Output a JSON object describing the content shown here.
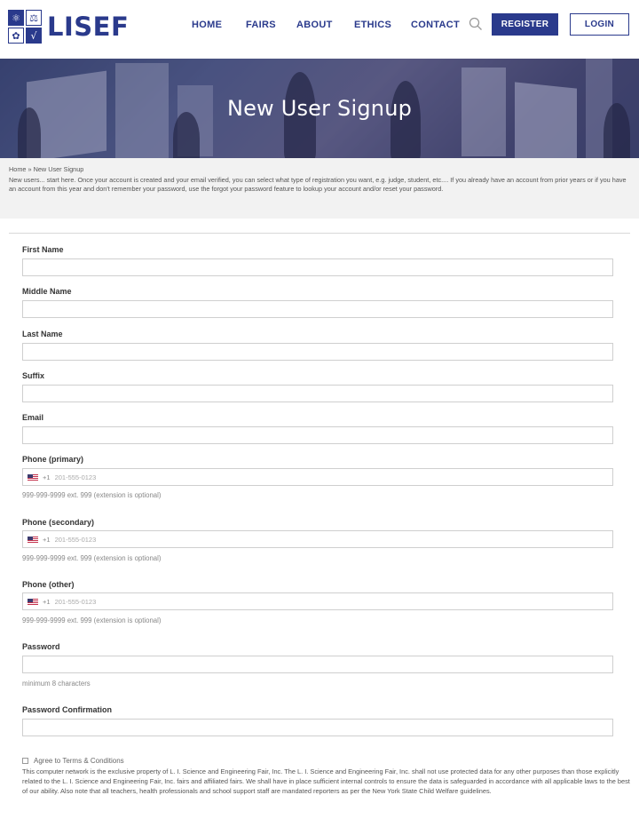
{
  "brand": {
    "name": "LISEF"
  },
  "nav": {
    "home": "HOME",
    "fairs": "FAIRS",
    "about": "ABOUT",
    "ethics": "ETHICS",
    "contact": "CONTACT",
    "register": "REGISTER",
    "login": "LOGIN"
  },
  "banner": {
    "title": "New User Signup"
  },
  "intro": {
    "breadcrumb": "Home » New User Signup",
    "text": "New users... start here. Once your account is created and your email verified, you can select what type of registration you want, e.g. judge, student, etc.... If you already have an account from prior years or if you have an account from this year and don't remember your password, use the forgot your password feature to lookup your account and/or reset your password."
  },
  "form": {
    "first_name": {
      "label": "First Name",
      "value": ""
    },
    "middle_name": {
      "label": "Middle Name",
      "value": ""
    },
    "last_name": {
      "label": "Last Name",
      "value": ""
    },
    "suffix": {
      "label": "Suffix",
      "value": ""
    },
    "email": {
      "label": "Email",
      "value": ""
    },
    "phone_primary": {
      "label": "Phone (primary)",
      "country_code": "+1",
      "placeholder": "201-555-0123",
      "help": "999-999-9999 ext. 999 (extension is optional)"
    },
    "phone_secondary": {
      "label": "Phone (secondary)",
      "country_code": "+1",
      "placeholder": "201-555-0123",
      "help": "999-999-9999 ext. 999 (extension is optional)"
    },
    "phone_other": {
      "label": "Phone (other)",
      "country_code": "+1",
      "placeholder": "201-555-0123",
      "help": "999-999-9999 ext. 999 (extension is optional)"
    },
    "password": {
      "label": "Password",
      "help": "minimum 8 characters"
    },
    "password_confirmation": {
      "label": "Password Confirmation"
    },
    "terms": {
      "label": "Agree to Terms & Conditions",
      "checked": false
    },
    "legal": "This computer network is the exclusive property of L. I. Science and Engineering Fair, Inc. The L. I. Science and Engineering Fair, Inc. shall not use protected data for any other purposes than those explicitly related to the L. I. Science and Engineering Fair, Inc. fairs and affiliated fairs. We shall have in place sufficient internal controls to ensure the data is safeguarded in accordance with all applicable laws to the best of our ability. Also note that all teachers, health professionals and school support staff are mandated reporters as per the New York State Child Welfare guidelines."
  },
  "colors": {
    "brand": "#2a3a8c",
    "banner_overlay": "#3a4770"
  }
}
